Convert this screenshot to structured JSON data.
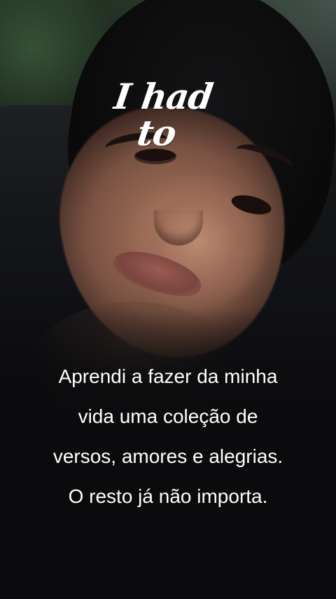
{
  "title": {
    "line1": "I had",
    "line2": "to"
  },
  "quote": {
    "lines": [
      "Aprendi a fazer da minha",
      "vida uma coleção de",
      "versos, amores e alegrias.",
      "O resto já não importa."
    ]
  }
}
